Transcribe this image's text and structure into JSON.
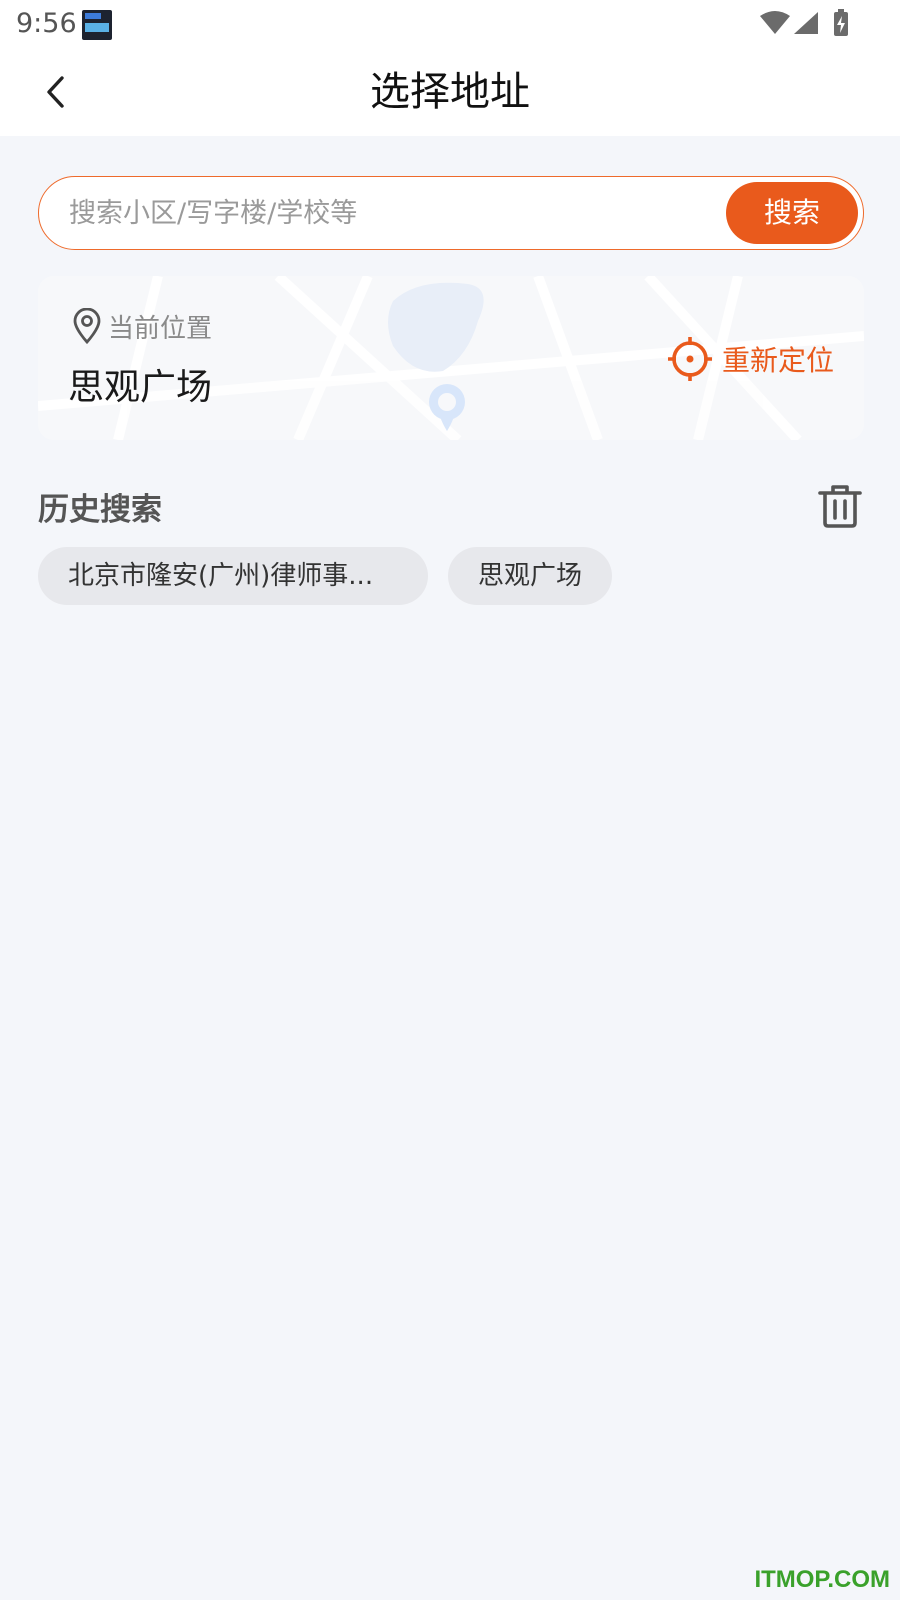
{
  "status_bar": {
    "time": "9:56",
    "icons": [
      "notification-icon",
      "wifi-icon",
      "signal-icon",
      "battery-charging-icon"
    ]
  },
  "nav": {
    "title": "选择地址",
    "back_icon": "chevron-left-icon"
  },
  "search": {
    "placeholder": "搜索小区/写字楼/学校等",
    "value": "",
    "button_label": "搜索"
  },
  "location": {
    "label": "当前位置",
    "name": "思观广场",
    "relocate_label": "重新定位",
    "pin_icon": "location-pin-icon",
    "relocate_icon": "crosshair-icon"
  },
  "history": {
    "title": "历史搜索",
    "clear_icon": "trash-icon",
    "items": [
      "北京市隆安(广州)律师事...",
      "思观广场"
    ]
  },
  "watermark": "ITMOP.COM",
  "colors": {
    "accent": "#e95a1c",
    "background": "#f4f6fa",
    "chip_bg": "#e7e8ec",
    "watermark": "#3aa12b"
  }
}
